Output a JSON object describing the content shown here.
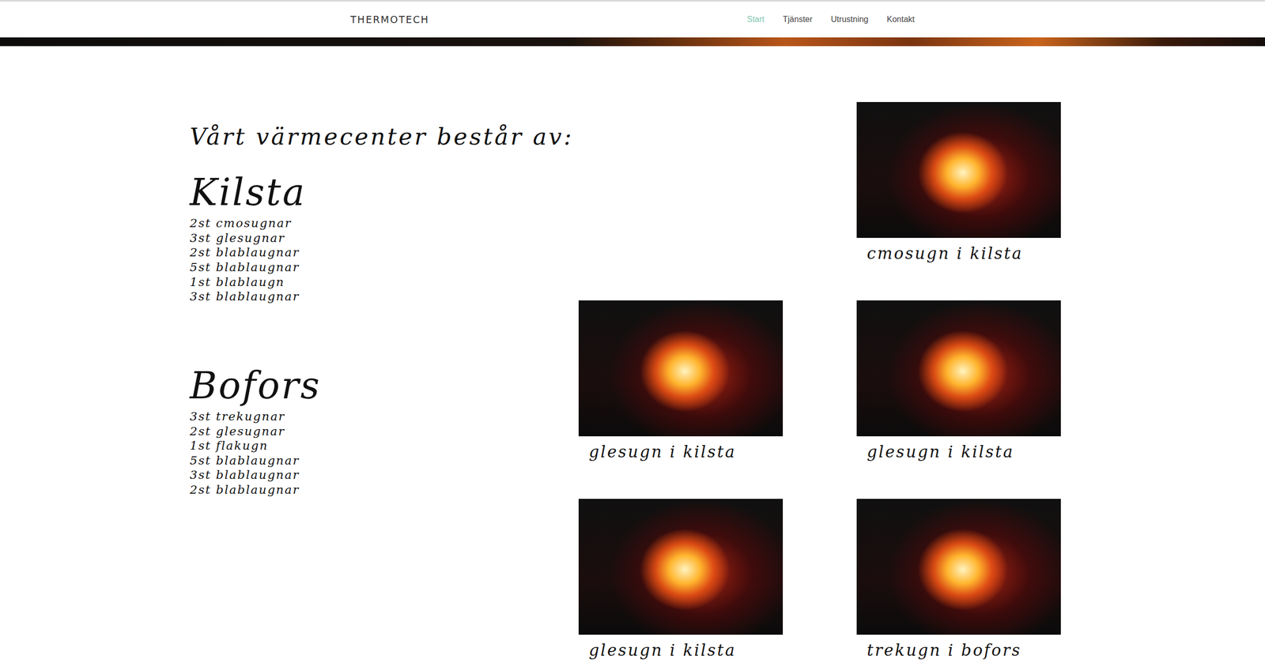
{
  "brand": "THERMOTECH",
  "nav": {
    "items": [
      {
        "label": "Start",
        "selected": true
      },
      {
        "label": "Tjänster",
        "selected": false
      },
      {
        "label": "Utrustning",
        "selected": false
      },
      {
        "label": "Kontakt",
        "selected": false
      }
    ]
  },
  "heading": "Vårt värmecenter består av:",
  "sites": [
    {
      "name": "Kilsta",
      "items": [
        "2st cmosugnar",
        "3st glesugnar",
        "2st blablaugnar",
        "5st blablaugnar",
        "1st blablaugn",
        "3st blablaugnar"
      ]
    },
    {
      "name": "Bofors",
      "items": [
        "3st trekugnar",
        "2st glesugnar",
        "1st flakugn",
        "5st blablaugnar",
        "3st blablaugnar",
        "2st blablaugnar"
      ]
    }
  ],
  "gallery": [
    {
      "caption": "cmosugn i kilsta"
    },
    {
      "caption": "glesugn i kilsta"
    },
    {
      "caption": "glesugn i kilsta"
    },
    {
      "caption": "glesugn i kilsta"
    },
    {
      "caption": "trekugn i bofors"
    }
  ]
}
